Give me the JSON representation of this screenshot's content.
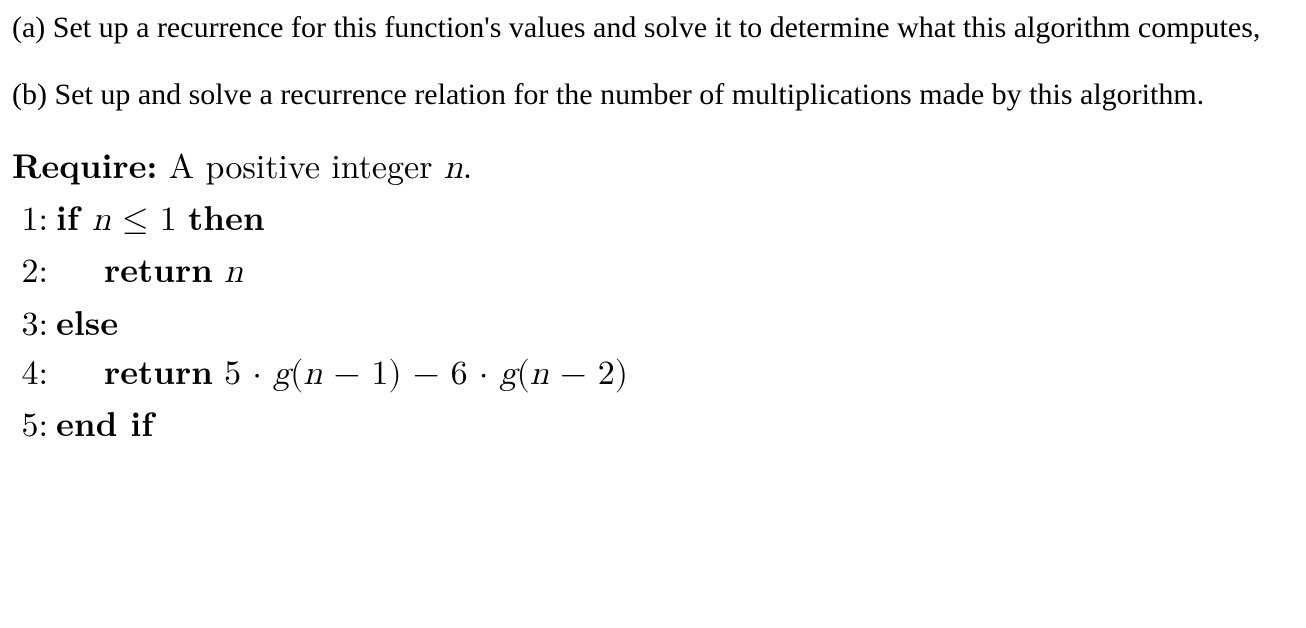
{
  "questions": {
    "a": "(a) Set up a recurrence for this function's values and solve it to determine what this algorithm computes,",
    "b": "(b) Set up and solve a recurrence relation for the number of multiplications made by this algorithm."
  },
  "algorithm": {
    "require_label": "Require:",
    "require_text": " A positive integer ",
    "require_var": "n",
    "require_period": ".",
    "lines": {
      "l1": {
        "num": "1:",
        "kw": "if ",
        "cond_var": "n",
        "cond_rest": " ≤ 1 ",
        "kw2": "then"
      },
      "l2": {
        "num": "2:",
        "kw": "return",
        "sp": "  ",
        "var": "n"
      },
      "l3": {
        "num": "3:",
        "kw": "else"
      },
      "l4": {
        "num": "4:",
        "kw": "return",
        "sp": "  ",
        "expr_a": "5 · ",
        "expr_g1": "g",
        "expr_b": "(",
        "expr_n1": "n",
        "expr_c": " − 1) − 6 · ",
        "expr_g2": "g",
        "expr_d": "(",
        "expr_n2": "n",
        "expr_e": " − 2)"
      },
      "l5": {
        "num": "5:",
        "kw": "end if"
      }
    }
  }
}
